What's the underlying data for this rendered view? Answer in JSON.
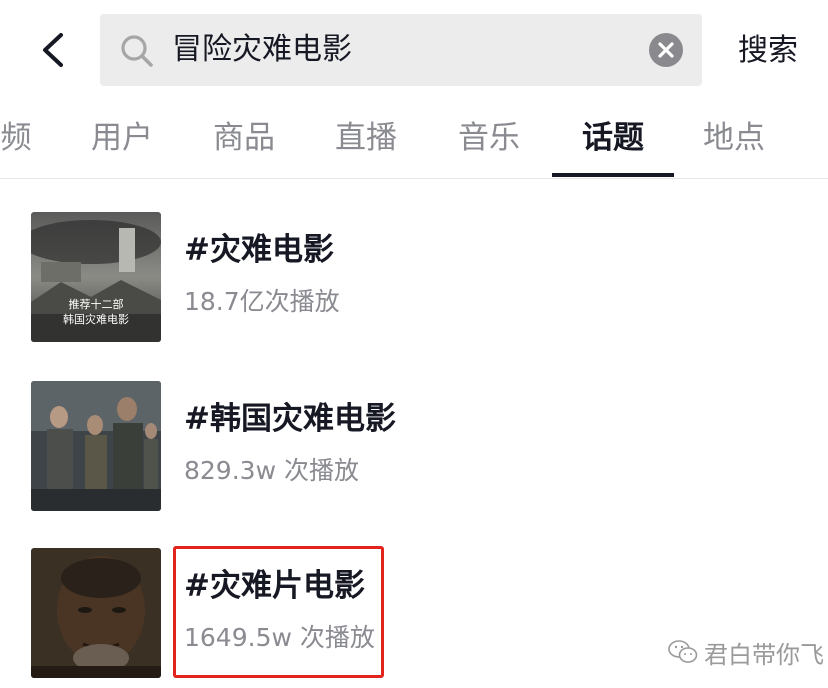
{
  "search": {
    "query": "冒险灾难电影",
    "submit_label": "搜索"
  },
  "tabs": [
    {
      "label": "频",
      "active": false
    },
    {
      "label": "用户",
      "active": false
    },
    {
      "label": "商品",
      "active": false
    },
    {
      "label": "直播",
      "active": false
    },
    {
      "label": "音乐",
      "active": false
    },
    {
      "label": "话题",
      "active": true
    },
    {
      "label": "地点",
      "active": false
    }
  ],
  "results": [
    {
      "title": "#灾难电影",
      "plays": "18.7亿次播放",
      "thumb_caption": [
        "推荐十二部",
        "韩国灾难电影"
      ]
    },
    {
      "title": "#韩国灾难电影",
      "plays": "829.3w 次播放"
    },
    {
      "title": "#灾难片电影",
      "plays": "1649.5w 次播放",
      "highlighted": true
    }
  ],
  "watermark": {
    "text": "君白带你飞",
    "icon": "wechat-icon"
  },
  "colors": {
    "highlight": "#e3241d",
    "active_tab": "#161823",
    "muted": "#8a8b91",
    "search_bg": "#ececec"
  }
}
